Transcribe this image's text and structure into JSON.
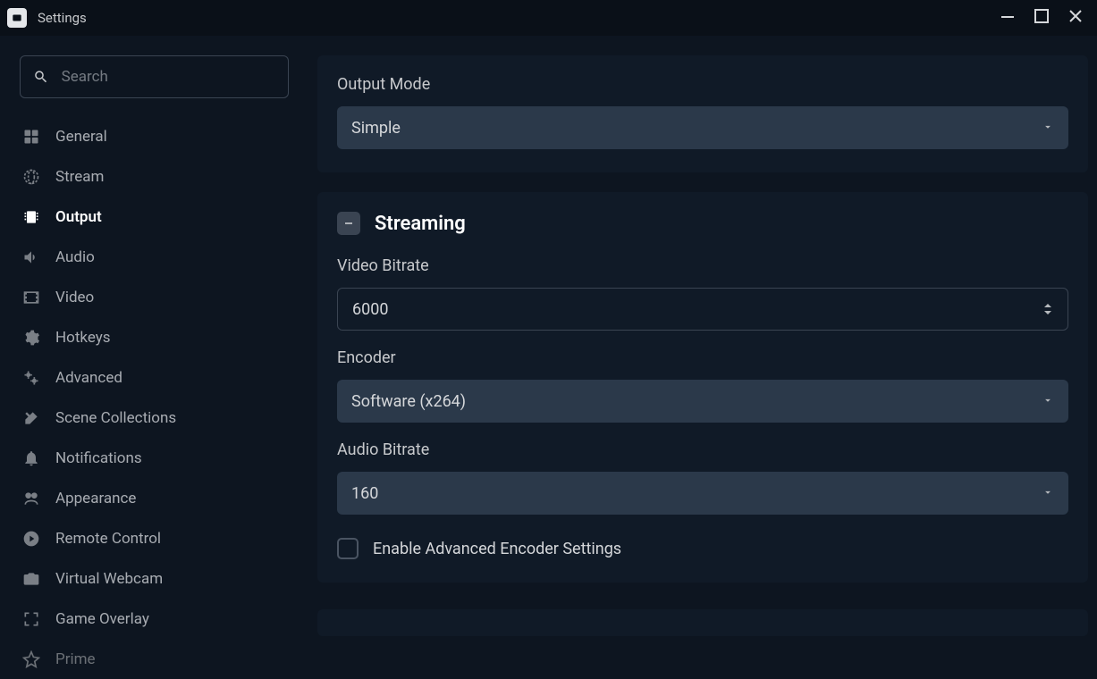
{
  "window": {
    "title": "Settings"
  },
  "search": {
    "placeholder": "Search"
  },
  "sidebar": {
    "items": [
      {
        "label": "General"
      },
      {
        "label": "Stream"
      },
      {
        "label": "Output",
        "active": true
      },
      {
        "label": "Audio"
      },
      {
        "label": "Video"
      },
      {
        "label": "Hotkeys"
      },
      {
        "label": "Advanced"
      },
      {
        "label": "Scene Collections"
      },
      {
        "label": "Notifications"
      },
      {
        "label": "Appearance"
      },
      {
        "label": "Remote Control"
      },
      {
        "label": "Virtual Webcam"
      },
      {
        "label": "Game Overlay"
      },
      {
        "label": "Prime"
      }
    ]
  },
  "output": {
    "mode_label": "Output Mode",
    "mode_value": "Simple",
    "streaming": {
      "title": "Streaming",
      "video_bitrate_label": "Video Bitrate",
      "video_bitrate_value": "6000",
      "encoder_label": "Encoder",
      "encoder_value": "Software (x264)",
      "audio_bitrate_label": "Audio Bitrate",
      "audio_bitrate_value": "160",
      "enable_advanced_label": "Enable Advanced Encoder Settings",
      "enable_advanced_checked": false
    }
  }
}
